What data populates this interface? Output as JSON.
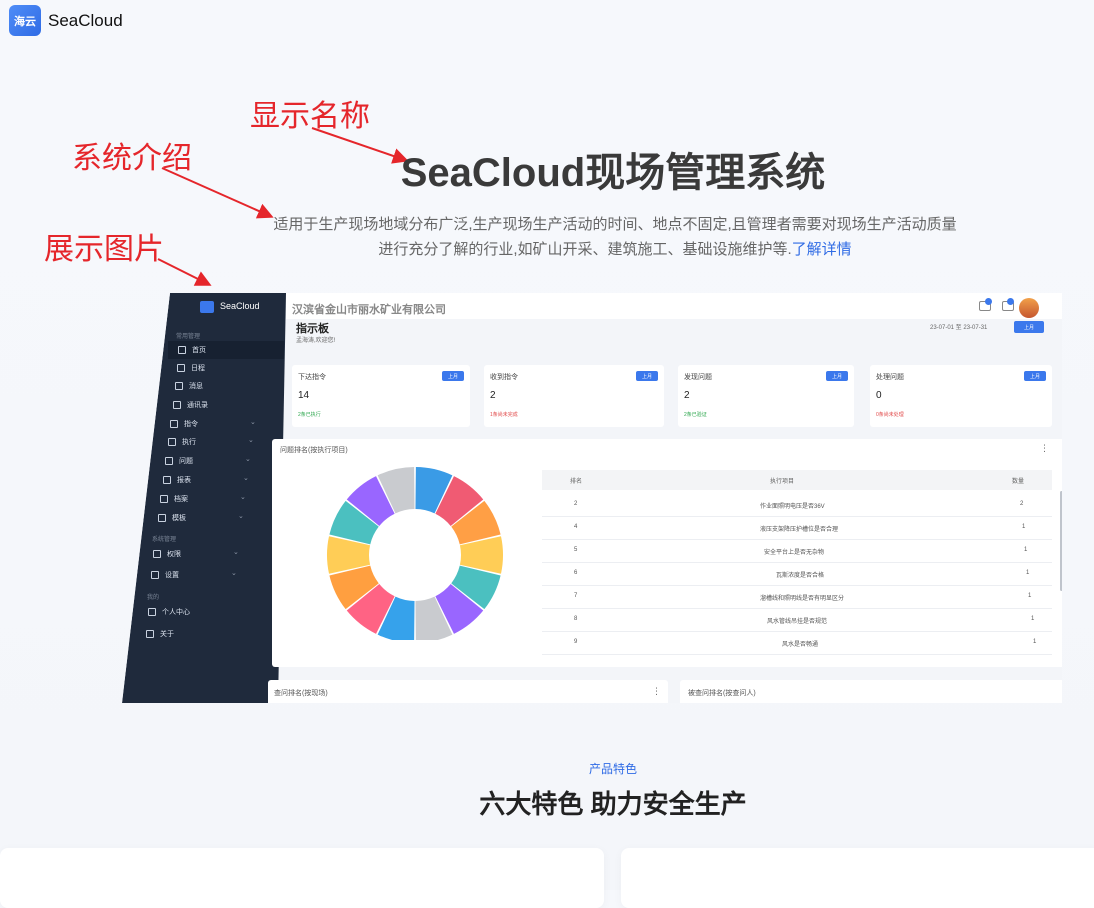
{
  "header": {
    "logo_text": "海云",
    "brand": "SeaCloud"
  },
  "annotations": {
    "display_name": "显示名称",
    "system_intro": "系统介绍",
    "show_image": "展示图片"
  },
  "hero": {
    "title": "SeaCloud现场管理系统",
    "description": "适用于生产现场地域分布广泛,生产现场生产活动的时间、地点不固定,且管理者需要对现场生产活动质量进行充分了解的行业,如矿山开采、建筑施工、基础设施维护等.",
    "link": "了解详情"
  },
  "screenshot": {
    "brand": "SeaCloud",
    "company": "汉滨省金山市丽水矿业有限公司",
    "sidebar": {
      "section1": "常用管理",
      "items1": [
        "首页",
        "日程",
        "消息",
        "通讯录",
        "指令",
        "执行",
        "问题",
        "报表",
        "档案",
        "模板"
      ],
      "section2": "系统管理",
      "items2": [
        "权限",
        "设置"
      ],
      "section3": "我的",
      "items3": [
        "个人中心",
        "关于"
      ]
    },
    "dashboard": {
      "title": "指示板",
      "greeting": "孟海涛,欢迎您!"
    },
    "date_range": "23-07-01 至 23-07-31",
    "last_month": "上月",
    "cards": [
      {
        "label": "下达指令",
        "value": "14",
        "note": "2条已执行",
        "note_color": "#2fa84f"
      },
      {
        "label": "收到指令",
        "value": "2",
        "note": "1条尚未完成",
        "note_color": "#e14b4b"
      },
      {
        "label": "发现问题",
        "value": "2",
        "note": "2条已验证",
        "note_color": "#2fa84f"
      },
      {
        "label": "处理问题",
        "value": "0",
        "note": "0条尚未处理",
        "note_color": "#e14b4b"
      }
    ],
    "panel_title": "问题排名(按执行项目)",
    "table": {
      "headers": [
        "排名",
        "执行项目",
        "数量"
      ],
      "rows": [
        {
          "rank": "2",
          "item": "作业面照明电压是否36V",
          "count": "2"
        },
        {
          "rank": "4",
          "item": "液压支架降压护槽位是否合理",
          "count": "1"
        },
        {
          "rank": "5",
          "item": "安全平台上是否无杂物",
          "count": "1"
        },
        {
          "rank": "6",
          "item": "瓦斯浓度是否合格",
          "count": "1"
        },
        {
          "rank": "7",
          "item": "溜槽线和照明线是否有明显区分",
          "count": "1"
        },
        {
          "rank": "8",
          "item": "风水管线吊挂是否规范",
          "count": "1"
        },
        {
          "rank": "9",
          "item": "风水是否畅通",
          "count": "1"
        }
      ]
    },
    "donut_colors": [
      "#3a9be6",
      "#f05b73",
      "#ff9f45",
      "#ffcd56",
      "#4bc0c0",
      "#9966ff",
      "#c9cbcf",
      "#36a2eb",
      "#ff6384",
      "#ff9f40",
      "#ffcd56",
      "#4bc0c0",
      "#9966ff",
      "#c9cbcf"
    ],
    "bottom_left": "查问排名(按现场)",
    "bottom_right": "被查问排名(按查问人)"
  },
  "features": {
    "kicker": "产品特色",
    "title": "六大特色 助力安全生产"
  }
}
